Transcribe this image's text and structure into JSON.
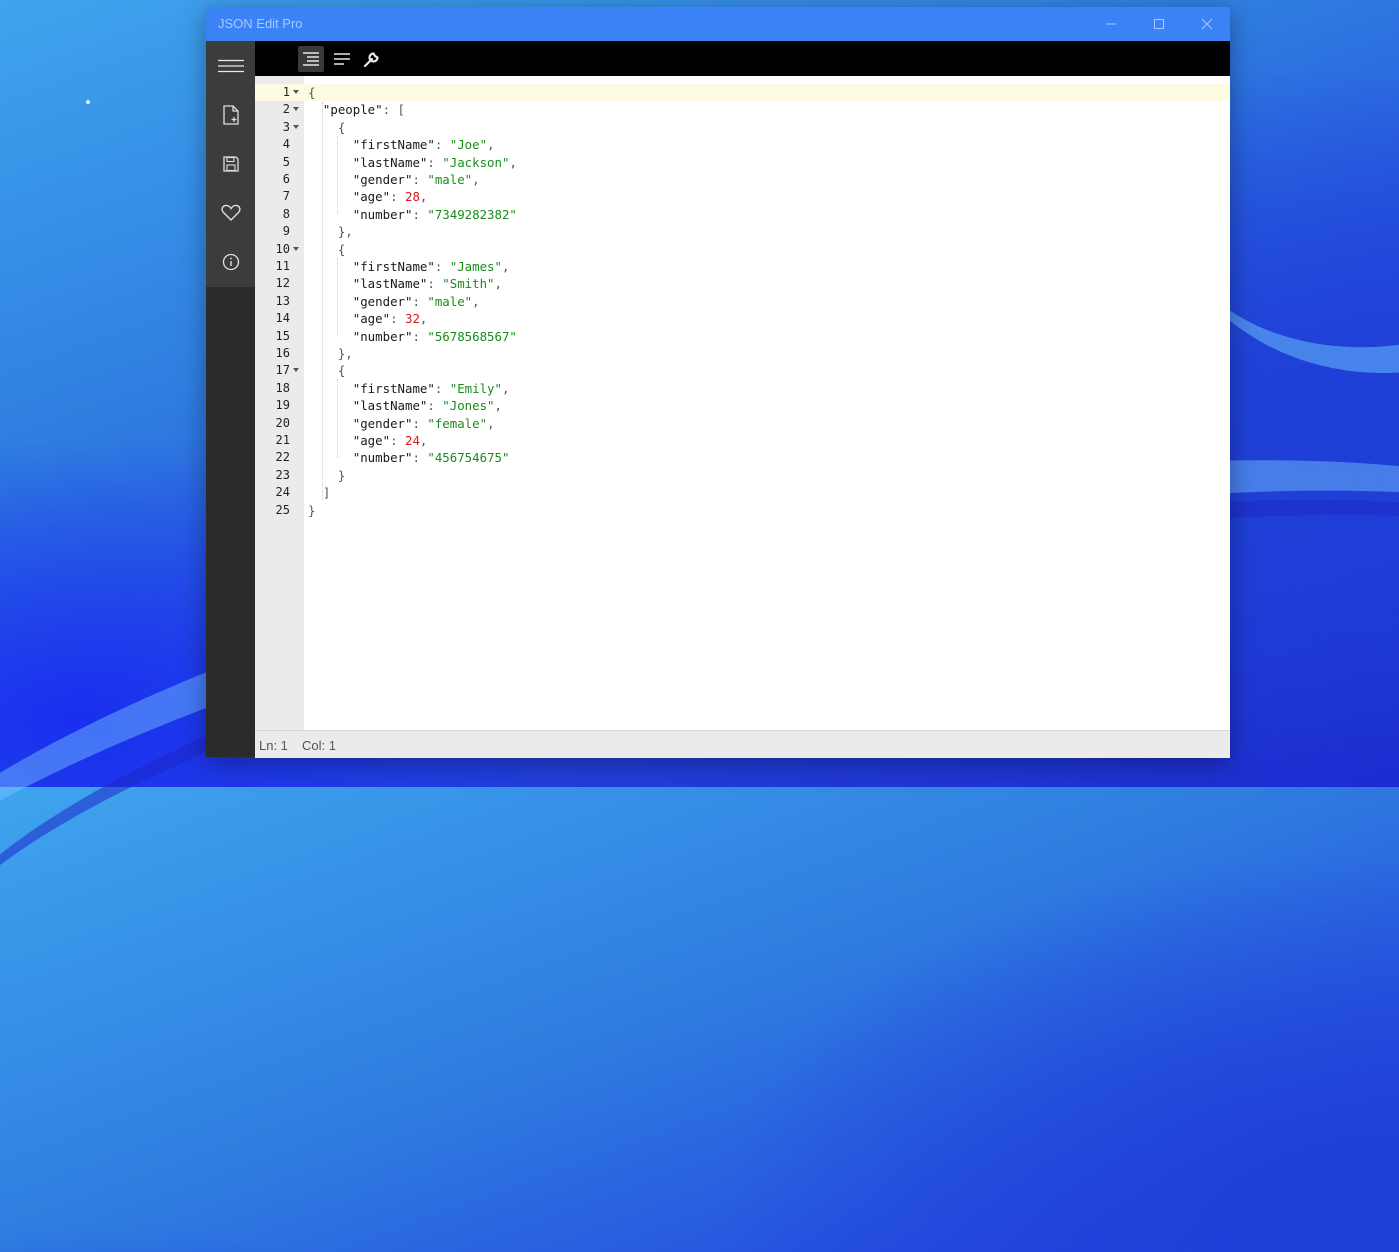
{
  "window": {
    "title": "JSON Edit Pro",
    "accent_color": "#3a82f6",
    "controls": [
      "minimize-icon",
      "maximize-icon",
      "close-icon"
    ]
  },
  "sidebar": {
    "items": [
      {
        "name": "menu",
        "icon": "hamburger-menu-icon"
      },
      {
        "name": "new-file",
        "icon": "new-file-icon"
      },
      {
        "name": "save",
        "icon": "save-icon"
      },
      {
        "name": "favorite",
        "icon": "heart-icon"
      },
      {
        "name": "info",
        "icon": "info-icon"
      }
    ]
  },
  "toolbar": {
    "buttons": [
      {
        "name": "format",
        "icon": "format-indent-icon",
        "active": true
      },
      {
        "name": "compact",
        "icon": "align-left-icon",
        "active": false
      },
      {
        "name": "tools",
        "icon": "wrench-icon",
        "active": false
      }
    ]
  },
  "editor": {
    "active_line": 1,
    "foldable_lines": [
      1,
      2,
      3,
      10,
      17
    ],
    "lines": [
      {
        "n": "1",
        "tokens": [
          {
            "t": "{",
            "c": "p"
          }
        ]
      },
      {
        "n": "2",
        "tokens": [
          {
            "t": "  ",
            "c": "p"
          },
          {
            "t": "\"people\"",
            "c": "k"
          },
          {
            "t": ": [",
            "c": "p"
          }
        ]
      },
      {
        "n": "3",
        "tokens": [
          {
            "t": "    {",
            "c": "p"
          }
        ]
      },
      {
        "n": "4",
        "tokens": [
          {
            "t": "      ",
            "c": "p"
          },
          {
            "t": "\"firstName\"",
            "c": "k"
          },
          {
            "t": ": ",
            "c": "p"
          },
          {
            "t": "\"Joe\"",
            "c": "s"
          },
          {
            "t": ",",
            "c": "p"
          }
        ]
      },
      {
        "n": "5",
        "tokens": [
          {
            "t": "      ",
            "c": "p"
          },
          {
            "t": "\"lastName\"",
            "c": "k"
          },
          {
            "t": ": ",
            "c": "p"
          },
          {
            "t": "\"Jackson\"",
            "c": "s"
          },
          {
            "t": ",",
            "c": "p"
          }
        ]
      },
      {
        "n": "6",
        "tokens": [
          {
            "t": "      ",
            "c": "p"
          },
          {
            "t": "\"gender\"",
            "c": "k"
          },
          {
            "t": ": ",
            "c": "p"
          },
          {
            "t": "\"male\"",
            "c": "s"
          },
          {
            "t": ",",
            "c": "p"
          }
        ]
      },
      {
        "n": "7",
        "tokens": [
          {
            "t": "      ",
            "c": "p"
          },
          {
            "t": "\"age\"",
            "c": "k"
          },
          {
            "t": ": ",
            "c": "p"
          },
          {
            "t": "28",
            "c": "n"
          },
          {
            "t": ",",
            "c": "p"
          }
        ]
      },
      {
        "n": "8",
        "tokens": [
          {
            "t": "      ",
            "c": "p"
          },
          {
            "t": "\"number\"",
            "c": "k"
          },
          {
            "t": ": ",
            "c": "p"
          },
          {
            "t": "\"7349282382\"",
            "c": "s"
          }
        ]
      },
      {
        "n": "9",
        "tokens": [
          {
            "t": "    },",
            "c": "p"
          }
        ]
      },
      {
        "n": "10",
        "tokens": [
          {
            "t": "    {",
            "c": "p"
          }
        ]
      },
      {
        "n": "11",
        "tokens": [
          {
            "t": "      ",
            "c": "p"
          },
          {
            "t": "\"firstName\"",
            "c": "k"
          },
          {
            "t": ": ",
            "c": "p"
          },
          {
            "t": "\"James\"",
            "c": "s"
          },
          {
            "t": ",",
            "c": "p"
          }
        ]
      },
      {
        "n": "12",
        "tokens": [
          {
            "t": "      ",
            "c": "p"
          },
          {
            "t": "\"lastName\"",
            "c": "k"
          },
          {
            "t": ": ",
            "c": "p"
          },
          {
            "t": "\"Smith\"",
            "c": "s"
          },
          {
            "t": ",",
            "c": "p"
          }
        ]
      },
      {
        "n": "13",
        "tokens": [
          {
            "t": "      ",
            "c": "p"
          },
          {
            "t": "\"gender\"",
            "c": "k"
          },
          {
            "t": ": ",
            "c": "p"
          },
          {
            "t": "\"male\"",
            "c": "s"
          },
          {
            "t": ",",
            "c": "p"
          }
        ]
      },
      {
        "n": "14",
        "tokens": [
          {
            "t": "      ",
            "c": "p"
          },
          {
            "t": "\"age\"",
            "c": "k"
          },
          {
            "t": ": ",
            "c": "p"
          },
          {
            "t": "32",
            "c": "n"
          },
          {
            "t": ",",
            "c": "p"
          }
        ]
      },
      {
        "n": "15",
        "tokens": [
          {
            "t": "      ",
            "c": "p"
          },
          {
            "t": "\"number\"",
            "c": "k"
          },
          {
            "t": ": ",
            "c": "p"
          },
          {
            "t": "\"5678568567\"",
            "c": "s"
          }
        ]
      },
      {
        "n": "16",
        "tokens": [
          {
            "t": "    },",
            "c": "p"
          }
        ]
      },
      {
        "n": "17",
        "tokens": [
          {
            "t": "    {",
            "c": "p"
          }
        ]
      },
      {
        "n": "18",
        "tokens": [
          {
            "t": "      ",
            "c": "p"
          },
          {
            "t": "\"firstName\"",
            "c": "k"
          },
          {
            "t": ": ",
            "c": "p"
          },
          {
            "t": "\"Emily\"",
            "c": "s"
          },
          {
            "t": ",",
            "c": "p"
          }
        ]
      },
      {
        "n": "19",
        "tokens": [
          {
            "t": "      ",
            "c": "p"
          },
          {
            "t": "\"lastName\"",
            "c": "k"
          },
          {
            "t": ": ",
            "c": "p"
          },
          {
            "t": "\"Jones\"",
            "c": "s"
          },
          {
            "t": ",",
            "c": "p"
          }
        ]
      },
      {
        "n": "20",
        "tokens": [
          {
            "t": "      ",
            "c": "p"
          },
          {
            "t": "\"gender\"",
            "c": "k"
          },
          {
            "t": ": ",
            "c": "p"
          },
          {
            "t": "\"female\"",
            "c": "s"
          },
          {
            "t": ",",
            "c": "p"
          }
        ]
      },
      {
        "n": "21",
        "tokens": [
          {
            "t": "      ",
            "c": "p"
          },
          {
            "t": "\"age\"",
            "c": "k"
          },
          {
            "t": ": ",
            "c": "p"
          },
          {
            "t": "24",
            "c": "n"
          },
          {
            "t": ",",
            "c": "p"
          }
        ]
      },
      {
        "n": "22",
        "tokens": [
          {
            "t": "      ",
            "c": "p"
          },
          {
            "t": "\"number\"",
            "c": "k"
          },
          {
            "t": ": ",
            "c": "p"
          },
          {
            "t": "\"456754675\"",
            "c": "s"
          }
        ]
      },
      {
        "n": "23",
        "tokens": [
          {
            "t": "    }",
            "c": "p"
          }
        ]
      },
      {
        "n": "24",
        "tokens": [
          {
            "t": "  ]",
            "c": "p"
          }
        ]
      },
      {
        "n": "25",
        "tokens": [
          {
            "t": "}",
            "c": "p"
          }
        ]
      }
    ]
  },
  "statusbar": {
    "line": "Ln: 1",
    "col": "Col: 1"
  }
}
